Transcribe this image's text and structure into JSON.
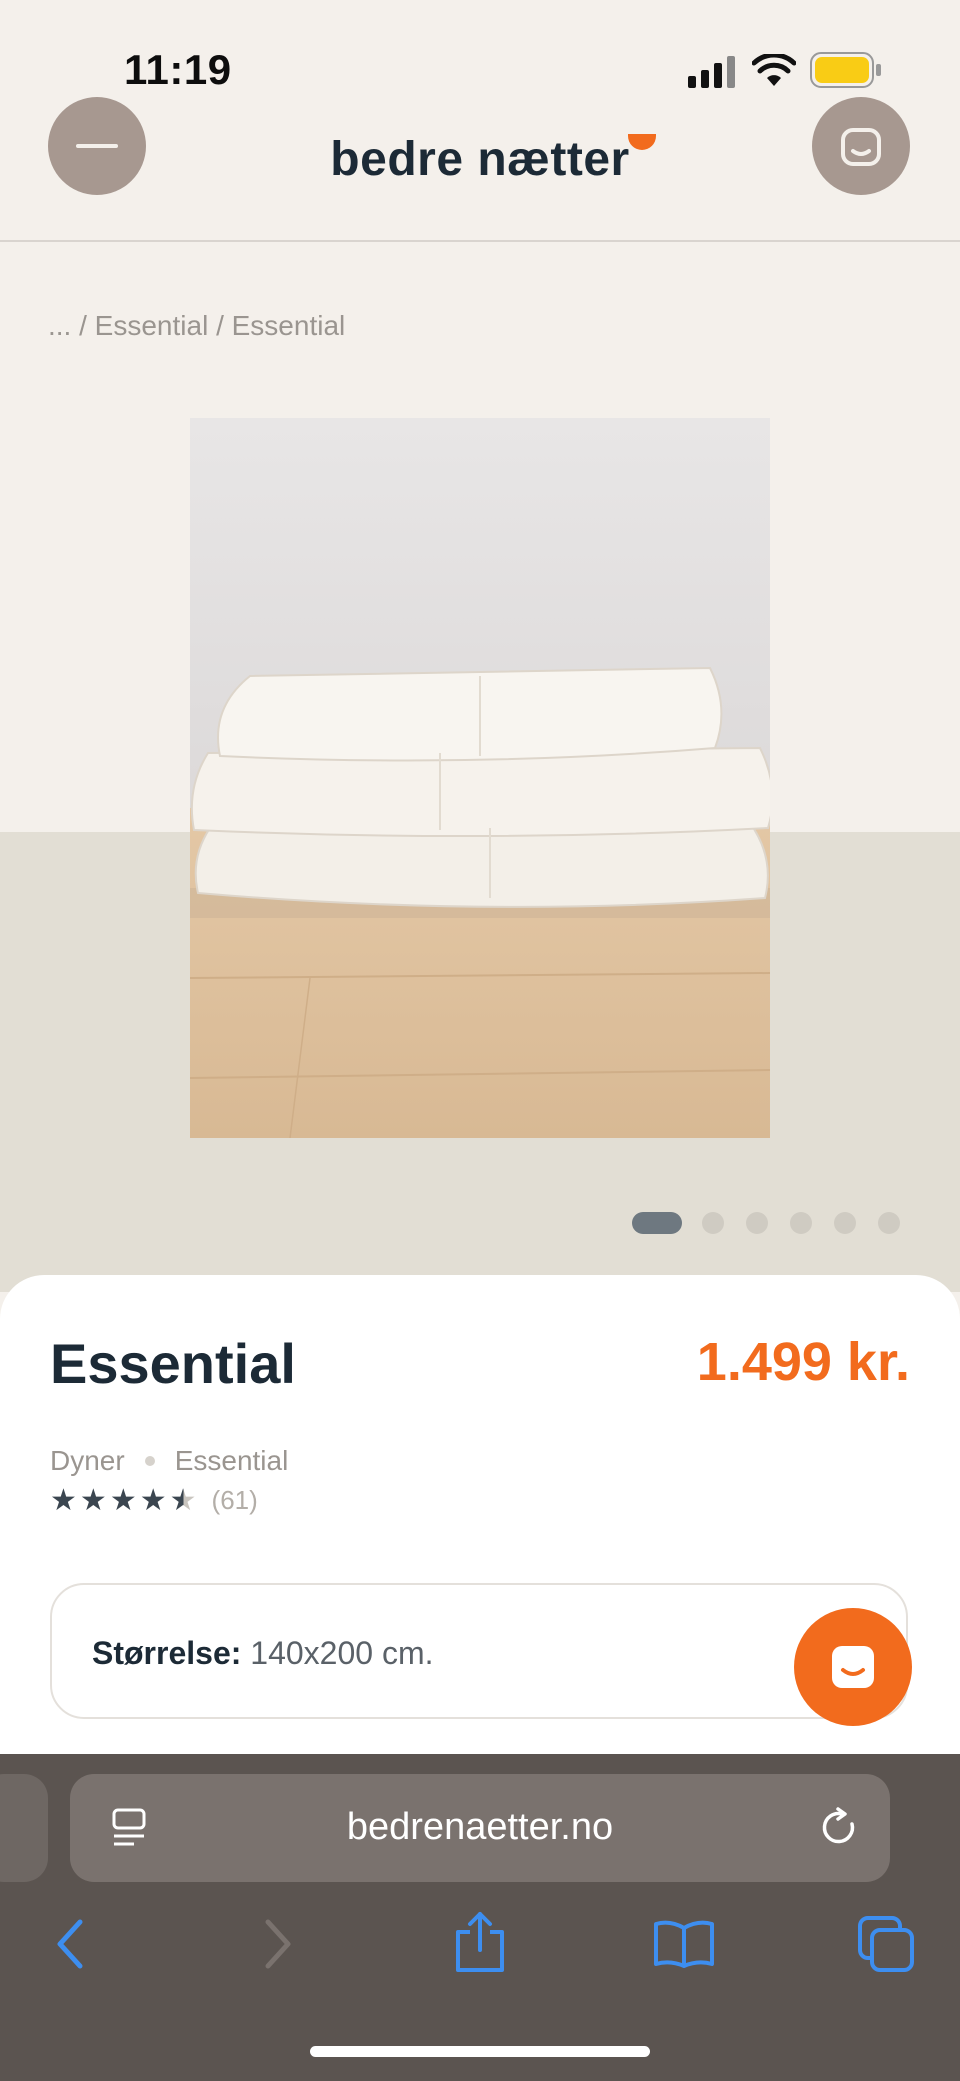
{
  "status_bar": {
    "time": "11:19"
  },
  "header": {
    "brand": "bedre nætter"
  },
  "breadcrumb": "... / Essential / Essential",
  "gallery": {
    "image_count": 6,
    "active_index": 1
  },
  "product": {
    "title": "Essential",
    "price": "1.499 kr.",
    "category": "Dyner",
    "collection": "Essential",
    "rating": 4.5,
    "review_count": "(61)"
  },
  "size": {
    "label": "Størrelse:",
    "value": "140x200 cm."
  },
  "browser": {
    "url": "bedrenaetter.no"
  },
  "colors": {
    "accent": "#f26b1d",
    "text": "#1c2a36",
    "browser_bg": "#5b5450",
    "browser_icon": "#3d8ef0"
  }
}
